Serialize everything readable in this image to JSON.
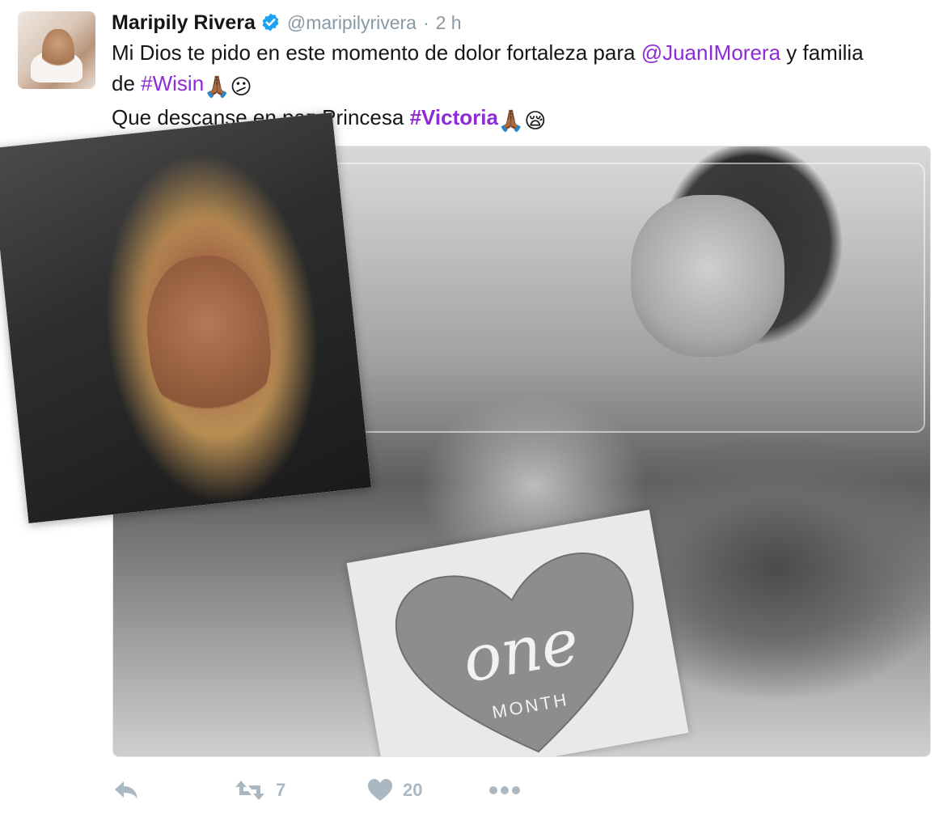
{
  "tweet": {
    "author_name": "Maripily Rivera",
    "handle": "@maripilyrivera",
    "separator": "·",
    "time": "2 h",
    "text": {
      "line1_prefix": "Mi Dios te pido en este momento de dolor fortaleza para ",
      "mention": "@JuanIMorera",
      "line1_suffix": " y familia",
      "line2_prefix": "de ",
      "hashtag1": "#Wisin",
      "emoji1": "🙏🏾",
      "emoji2": "😕",
      "line3_prefix": "Que descanse en paz Princesa ",
      "hashtag2": "#Victoria",
      "emoji3": "🙏🏾",
      "emoji4": "😪"
    },
    "media_text": {
      "one": "one",
      "month": "MONTH"
    },
    "actions": {
      "retweet_count": "7",
      "like_count": "20"
    }
  },
  "colors": {
    "link": "#8e2ad8",
    "verified": "#1da1f2",
    "muted": "#8899a6",
    "action_icon": "#aab8c2"
  },
  "icons": [
    "verified-badge-icon",
    "reply-icon",
    "retweet-icon",
    "heart-icon",
    "more-icon"
  ]
}
